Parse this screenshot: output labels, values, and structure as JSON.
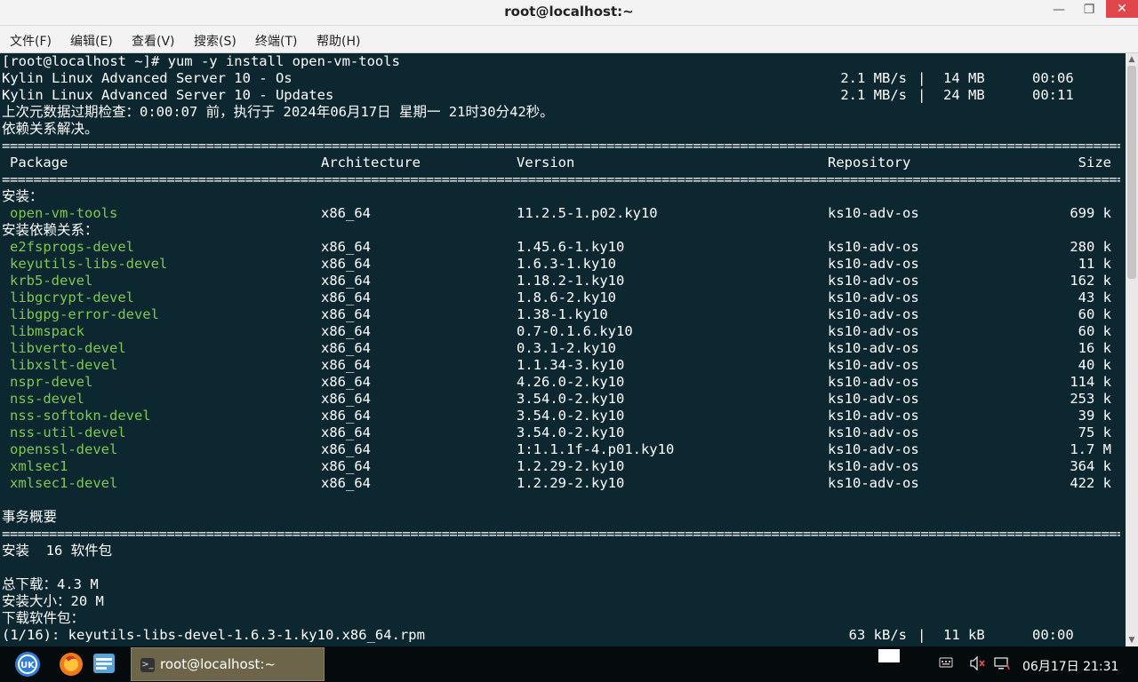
{
  "window": {
    "title": "root@localhost:~",
    "min": "—",
    "max": "❐",
    "close": "✕"
  },
  "menu": [
    "文件(F)",
    "编辑(E)",
    "查看(V)",
    "搜索(S)",
    "终端(T)",
    "帮助(H)"
  ],
  "terminal": {
    "prompt_line": "[root@localhost ~]# yum -y install open-vm-tools",
    "repos": [
      {
        "name": "Kylin Linux Advanced Server 10 - Os",
        "speed": "2.1 MB/s",
        "sep": "|",
        "size": "14 MB",
        "time": "00:06"
      },
      {
        "name": "Kylin Linux Advanced Server 10 - Updates",
        "speed": "2.1 MB/s",
        "sep": "|",
        "size": "24 MB",
        "time": "00:11"
      }
    ],
    "meta_check": "上次元数据过期检查：0:00:07 前，执行于 2024年06月17日 星期一 21时30分42秒。",
    "deps_resolved": "依赖关系解决。",
    "rule": "==========================================================================================================================================================================================",
    "headers": {
      "package": "Package",
      "arch": "Architecture",
      "version": "Version",
      "repo": "Repository",
      "size": "Size"
    },
    "install_heading": "安装：",
    "install_pkgs": [
      {
        "name": "open-vm-tools",
        "arch": "x86_64",
        "version": "11.2.5-1.p02.ky10",
        "repo": "ks10-adv-os",
        "size": "699 k"
      }
    ],
    "deps_heading": "安装依赖关系：",
    "dep_pkgs": [
      {
        "name": "e2fsprogs-devel",
        "arch": "x86_64",
        "version": "1.45.6-1.ky10",
        "repo": "ks10-adv-os",
        "size": "280 k"
      },
      {
        "name": "keyutils-libs-devel",
        "arch": "x86_64",
        "version": "1.6.3-1.ky10",
        "repo": "ks10-adv-os",
        "size": "11 k"
      },
      {
        "name": "krb5-devel",
        "arch": "x86_64",
        "version": "1.18.2-1.ky10",
        "repo": "ks10-adv-os",
        "size": "162 k"
      },
      {
        "name": "libgcrypt-devel",
        "arch": "x86_64",
        "version": "1.8.6-2.ky10",
        "repo": "ks10-adv-os",
        "size": "43 k"
      },
      {
        "name": "libgpg-error-devel",
        "arch": "x86_64",
        "version": "1.38-1.ky10",
        "repo": "ks10-adv-os",
        "size": "60 k"
      },
      {
        "name": "libmspack",
        "arch": "x86_64",
        "version": "0.7-0.1.6.ky10",
        "repo": "ks10-adv-os",
        "size": "60 k"
      },
      {
        "name": "libverto-devel",
        "arch": "x86_64",
        "version": "0.3.1-2.ky10",
        "repo": "ks10-adv-os",
        "size": "16 k"
      },
      {
        "name": "libxslt-devel",
        "arch": "x86_64",
        "version": "1.1.34-3.ky10",
        "repo": "ks10-adv-os",
        "size": "40 k"
      },
      {
        "name": "nspr-devel",
        "arch": "x86_64",
        "version": "4.26.0-2.ky10",
        "repo": "ks10-adv-os",
        "size": "114 k"
      },
      {
        "name": "nss-devel",
        "arch": "x86_64",
        "version": "3.54.0-2.ky10",
        "repo": "ks10-adv-os",
        "size": "253 k"
      },
      {
        "name": "nss-softokn-devel",
        "arch": "x86_64",
        "version": "3.54.0-2.ky10",
        "repo": "ks10-adv-os",
        "size": "39 k"
      },
      {
        "name": "nss-util-devel",
        "arch": "x86_64",
        "version": "3.54.0-2.ky10",
        "repo": "ks10-adv-os",
        "size": "75 k"
      },
      {
        "name": "openssl-devel",
        "arch": "x86_64",
        "version": "1:1.1.1f-4.p01.ky10",
        "repo": "ks10-adv-os",
        "size": "1.7 M"
      },
      {
        "name": "xmlsec1",
        "arch": "x86_64",
        "version": "1.2.29-2.ky10",
        "repo": "ks10-adv-os",
        "size": "364 k"
      },
      {
        "name": "xmlsec1-devel",
        "arch": "x86_64",
        "version": "1.2.29-2.ky10",
        "repo": "ks10-adv-os",
        "size": "422 k"
      }
    ],
    "summary_heading": "事务概要",
    "install_count": "安装  16 软件包",
    "total_download": "总下载：4.3 M",
    "install_size": "安装大小：20 M",
    "downloading": "下载软件包：",
    "progress": {
      "file": "(1/16): keyutils-libs-devel-1.6.3-1.ky10.x86_64.rpm",
      "speed": "63 kB/s",
      "sep": "|",
      "size": "11 kB",
      "time": "00:00"
    }
  },
  "scrollbar": {
    "up": "▲",
    "down": "▼"
  },
  "taskbar": {
    "task_label": "root@localhost:~",
    "task_icon": ">_",
    "clock": "06月17日 21:31",
    "colors": {
      "kylin": "#2f7fd8",
      "firefox": "#f07a1a",
      "files": "#5aa3d8"
    }
  }
}
